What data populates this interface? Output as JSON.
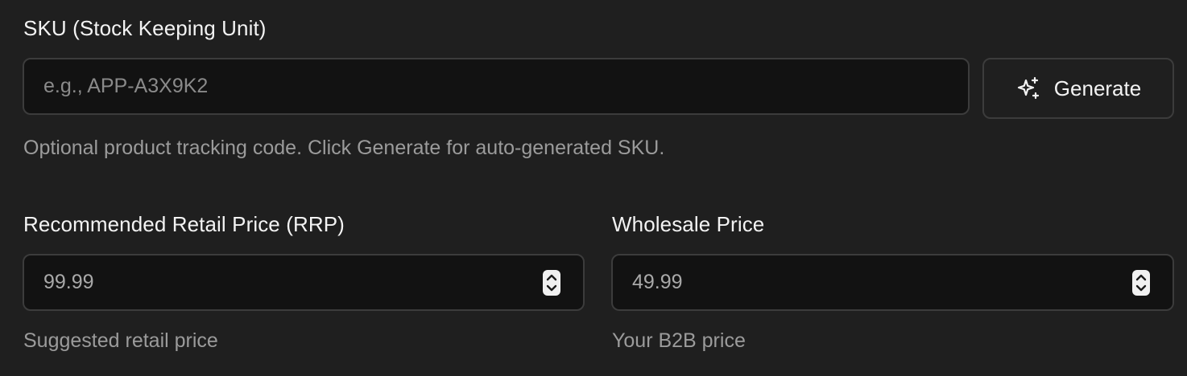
{
  "sku": {
    "label": "SKU (Stock Keeping Unit)",
    "placeholder": "e.g., APP-A3X9K2",
    "value": "",
    "generate_button": {
      "label": "Generate",
      "icon": "sparkles-icon"
    },
    "help": "Optional product tracking code. Click Generate for auto-generated SKU."
  },
  "rrp": {
    "label": "Recommended Retail Price (RRP)",
    "value": "99.99",
    "help": "Suggested retail price"
  },
  "wholesale": {
    "label": "Wholesale Price",
    "value": "49.99",
    "help": "Your B2B price"
  }
}
